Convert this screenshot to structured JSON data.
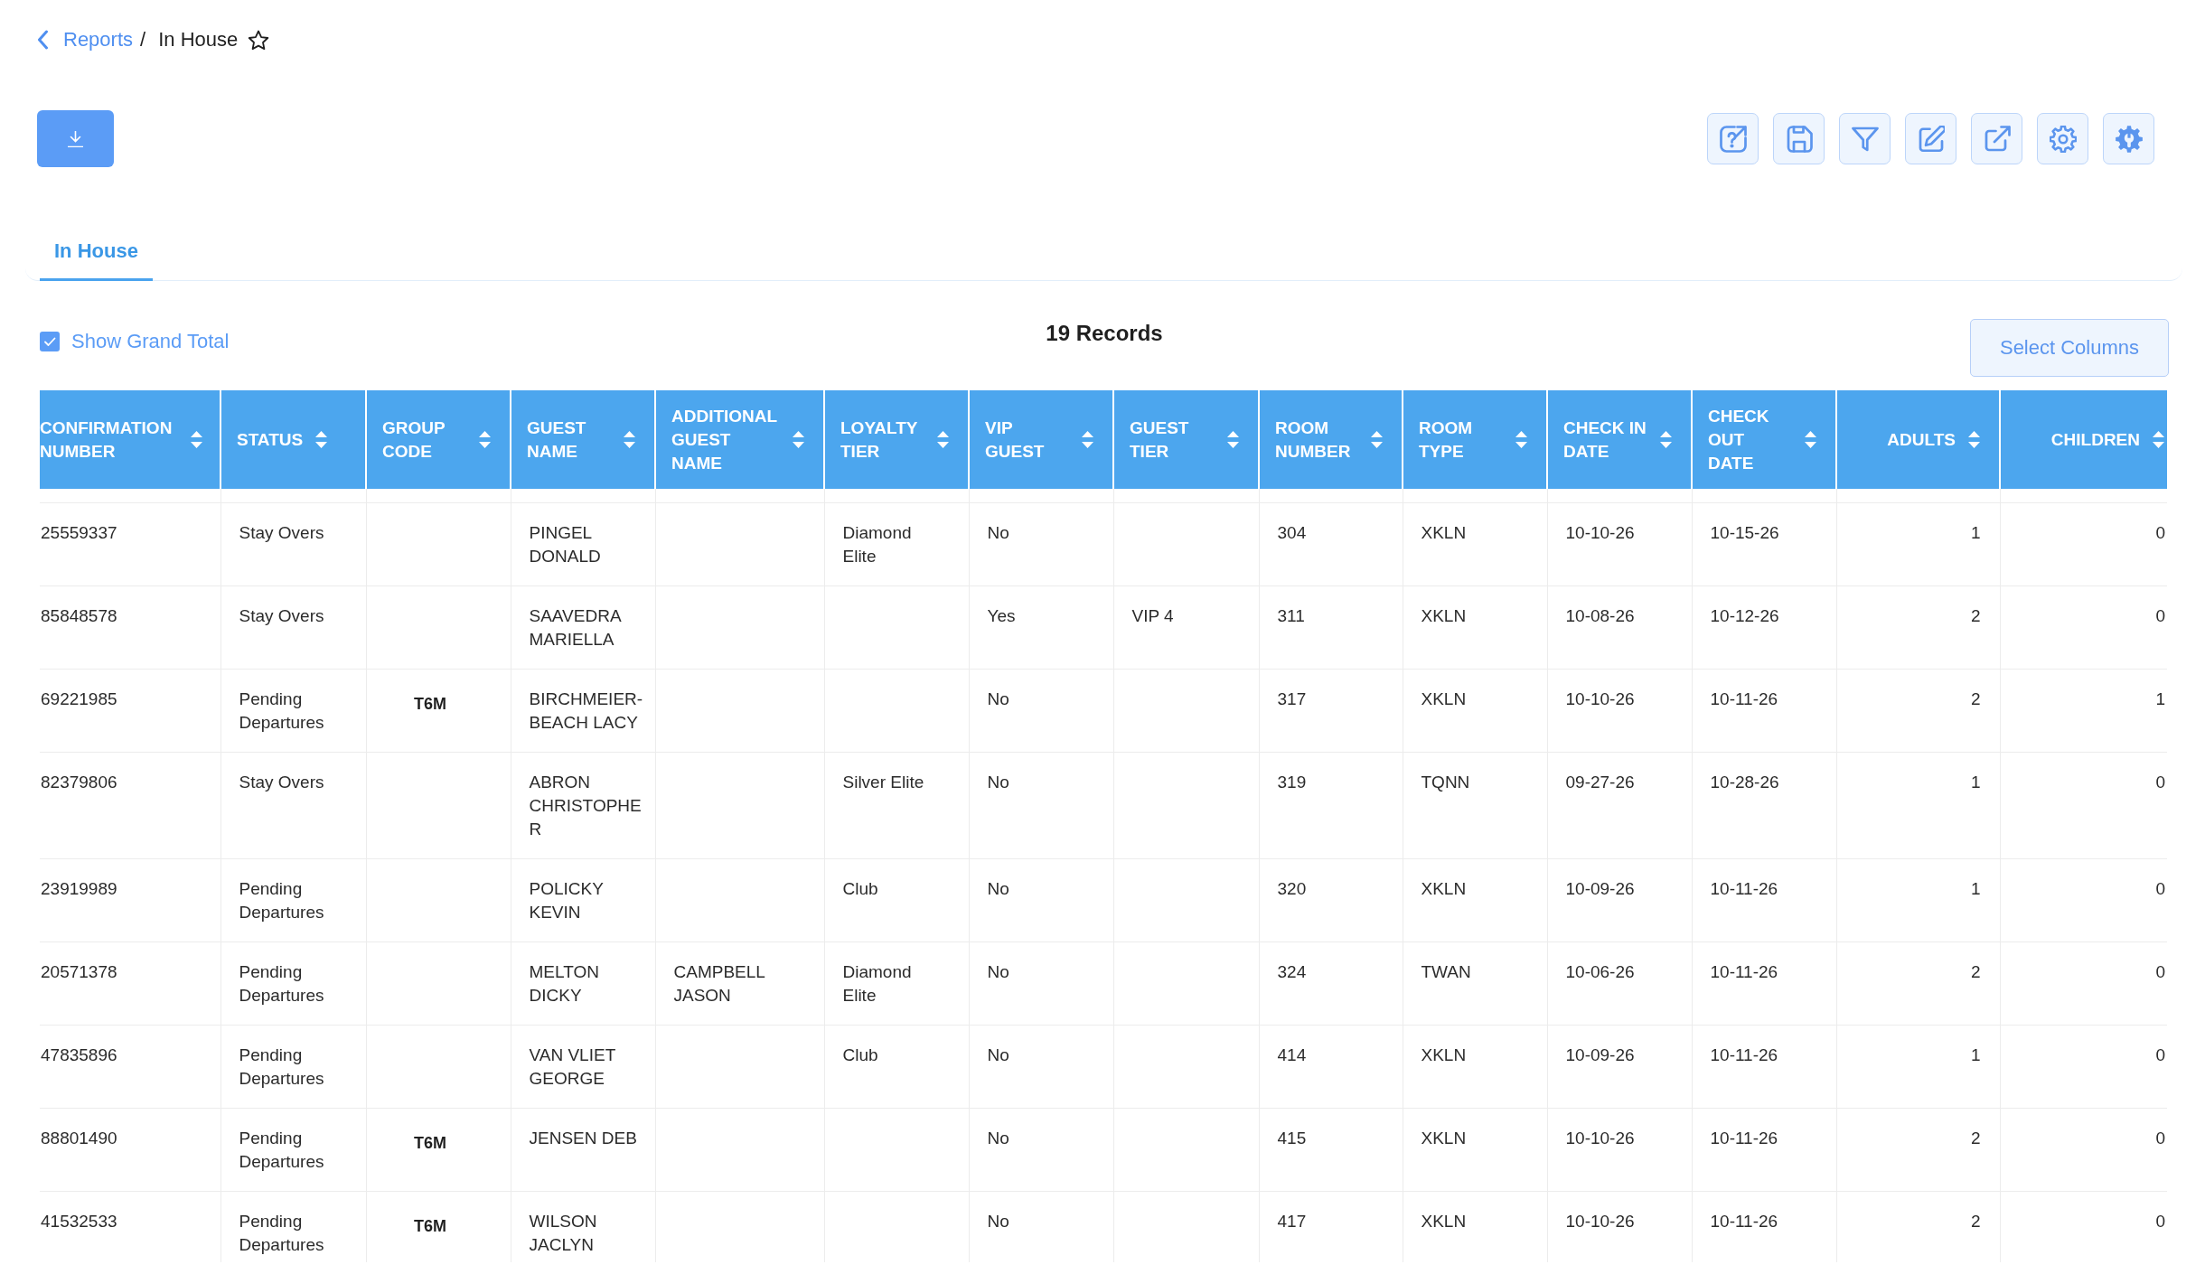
{
  "breadcrumb": {
    "items": [
      {
        "label": "Reports",
        "kind": "link"
      },
      {
        "label": "In House",
        "kind": "current"
      }
    ],
    "separator": "/",
    "favorite": false
  },
  "tabs": [
    {
      "label": "In House",
      "selected": true
    }
  ],
  "grand_total": {
    "label": "Show Grand Total",
    "checked": true
  },
  "record_count": "19 Records",
  "select_columns_button": "Select Columns",
  "table": {
    "columns": [
      {
        "label": "CONFIRMATION NUMBER",
        "kind": "text"
      },
      {
        "label": "STATUS",
        "kind": "text"
      },
      {
        "label": "GROUP CODE",
        "kind": "code"
      },
      {
        "label": "GUEST NAME",
        "kind": "text"
      },
      {
        "label": "ADDITIONAL GUEST NAME",
        "kind": "text"
      },
      {
        "label": "LOYALTY TIER",
        "kind": "text"
      },
      {
        "label": "VIP GUEST",
        "kind": "text"
      },
      {
        "label": "GUEST TIER",
        "kind": "text"
      },
      {
        "label": "ROOM NUMBER",
        "kind": "text"
      },
      {
        "label": "ROOM TYPE",
        "kind": "text"
      },
      {
        "label": "CHECK IN DATE",
        "kind": "text"
      },
      {
        "label": "CHECK OUT DATE",
        "kind": "text"
      },
      {
        "label": "ADULTS",
        "kind": "number"
      },
      {
        "label": "CHILDREN",
        "kind": "number"
      }
    ],
    "rows": [
      [
        "25559337",
        "Stay Overs",
        null,
        "PINGEL DONALD",
        null,
        "Diamond Elite",
        "No",
        null,
        "304",
        "XKLN",
        "10-10-26",
        "10-15-26",
        "1",
        "0"
      ],
      [
        "85848578",
        "Stay Overs",
        null,
        "SAAVEDRA MARIELLA",
        null,
        null,
        "Yes",
        "VIP 4",
        "311",
        "XKLN",
        "10-08-26",
        "10-12-26",
        "2",
        "0"
      ],
      [
        "69221985",
        "Pending Departures",
        "T6M",
        "BIRCHMEIER-BEACH LACY",
        null,
        null,
        "No",
        null,
        "317",
        "XKLN",
        "10-10-26",
        "10-11-26",
        "2",
        "1"
      ],
      [
        "82379806",
        "Stay Overs",
        null,
        "ABRON CHRISTOPHER",
        null,
        "Silver Elite",
        "No",
        null,
        "319",
        "TQNN",
        "09-27-26",
        "10-28-26",
        "1",
        "0"
      ],
      [
        "23919989",
        "Pending Departures",
        null,
        "POLICKY KEVIN",
        null,
        "Club",
        "No",
        null,
        "320",
        "XKLN",
        "10-09-26",
        "10-11-26",
        "1",
        "0"
      ],
      [
        "20571378",
        "Pending Departures",
        null,
        "MELTON DICKY",
        "CAMPBELL JASON",
        "Diamond Elite",
        "No",
        null,
        "324",
        "TWAN",
        "10-06-26",
        "10-11-26",
        "2",
        "0"
      ],
      [
        "47835896",
        "Pending Departures",
        null,
        "VAN VLIET GEORGE",
        null,
        "Club",
        "No",
        null,
        "414",
        "XKLN",
        "10-09-26",
        "10-11-26",
        "1",
        "0"
      ],
      [
        "88801490",
        "Pending Departures",
        "T6M",
        "JENSEN DEB",
        null,
        null,
        "No",
        null,
        "415",
        "XKLN",
        "10-10-26",
        "10-11-26",
        "2",
        "0"
      ],
      [
        "41532533",
        "Pending Departures",
        "T6M",
        "WILSON JACLYN",
        null,
        null,
        "No",
        null,
        "417",
        "XKLN",
        "10-10-26",
        "10-11-26",
        "2",
        "0"
      ]
    ]
  }
}
